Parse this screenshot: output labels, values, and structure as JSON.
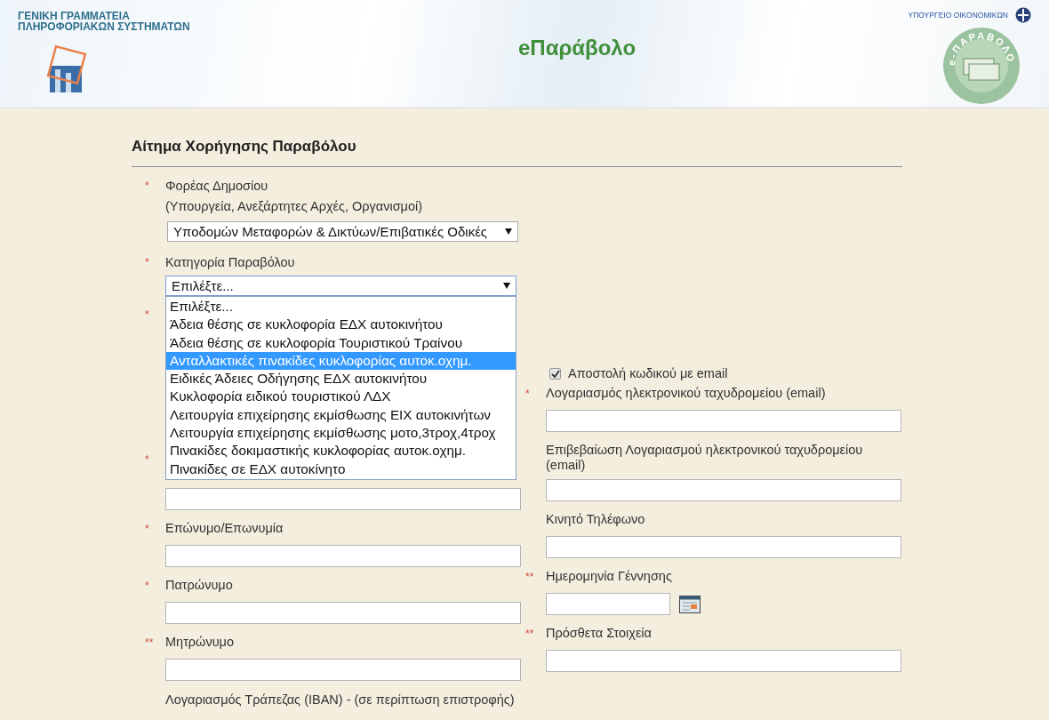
{
  "header": {
    "org_name": "ΓΕΝΙΚΗ ΓΡΑΜΜΑΤΕΙΑ\nΠΛΗΡΟΦΟΡΙΑΚΩΝ ΣΥΣΤΗΜΑΤΩΝ",
    "app_title": "eΠαράβολο",
    "ministry": "ΥΠΟΥΡΓΕΙΟ ΟΙΚΟΝΟΜΙΚΩΝ",
    "logo_text": "e-ΠΑΡΑΒΟΛΟ"
  },
  "form": {
    "title": "Αίτημα Χορήγησης Παραβόλου",
    "agency": {
      "marker": "*",
      "label": "Φορέας Δημοσίου",
      "hint": "(Υπουργεία, Ανεξάρτητες Αρχές, Οργανισμοί)",
      "value": "Υποδομών Μεταφορών & Δικτύων/Επιβατικές Οδικές"
    },
    "category": {
      "marker": "*",
      "label": "Κατηγορία Παραβόλου",
      "value": "Επιλέξτε...",
      "expanded": true,
      "options": [
        {
          "label": "Επιλέξτε...",
          "highlighted": false
        },
        {
          "label": "Άδεια θέσης σε κυκλοφορία ΕΔΧ αυτοκινήτου",
          "highlighted": false
        },
        {
          "label": "Άδεια θέσης σε κυκλοφορία Τουριστικού Τραίνου",
          "highlighted": false
        },
        {
          "label": "Ανταλλακτικές πινακίδες κυκλοφορίας αυτοκ.οχημ.",
          "highlighted": true
        },
        {
          "label": "Ειδικές Άδειες Οδήγησης ΕΔΧ αυτοκινήτου",
          "highlighted": false
        },
        {
          "label": "Κυκλοφορία ειδικού τουριστικού ΛΔΧ",
          "highlighted": false
        },
        {
          "label": "Λειτουργία επιχείρησης εκμίσθωσης ΕΙΧ αυτοκινήτων",
          "highlighted": false
        },
        {
          "label": "Λειτουργία επιχείρησης εκμίσθωσης μοτο,3τροχ,4τροχ",
          "highlighted": false
        },
        {
          "label": "Πινακίδες δοκιμαστικής κυκλοφορίας αυτοκ.οχημ.",
          "highlighted": false
        },
        {
          "label": "Πινακίδες σε ΕΔΧ αυτοκίνητο",
          "highlighted": false
        }
      ]
    },
    "left_fields": [
      {
        "kind": "covered",
        "marker": "*"
      },
      {
        "kind": "text",
        "marker": "*"
      },
      {
        "kind": "text",
        "marker": "*",
        "label": "Επώνυμο/Επωνυμία"
      },
      {
        "kind": "text",
        "marker": "*",
        "label": "Πατρώνυμο"
      },
      {
        "kind": "text",
        "marker": "**",
        "label": "Μητρώνυμο"
      },
      {
        "kind": "note",
        "label": "Λογαριασμός Τράπεζας (IBAN) - (σε περίπτωση επιστροφής)"
      }
    ],
    "right_fields": [
      {
        "kind": "checkbox",
        "label": "Αποστολή κωδικού με email",
        "checked": true
      },
      {
        "kind": "text",
        "marker": "*",
        "label": "Λογαριασμός ηλεκτρονικού ταχυδρομείου (email)"
      },
      {
        "kind": "text",
        "label": "Επιβεβαίωση Λογαριασμού ηλεκτρονικού ταχυδρομείου (email)"
      },
      {
        "kind": "text",
        "label": "Κινητό Τηλέφωνο"
      },
      {
        "kind": "date",
        "marker": "**",
        "label": "Ημερομηνία Γέννησης"
      },
      {
        "kind": "text",
        "marker": "**",
        "label": "Πρόσθετα Στοιχεία"
      }
    ]
  }
}
